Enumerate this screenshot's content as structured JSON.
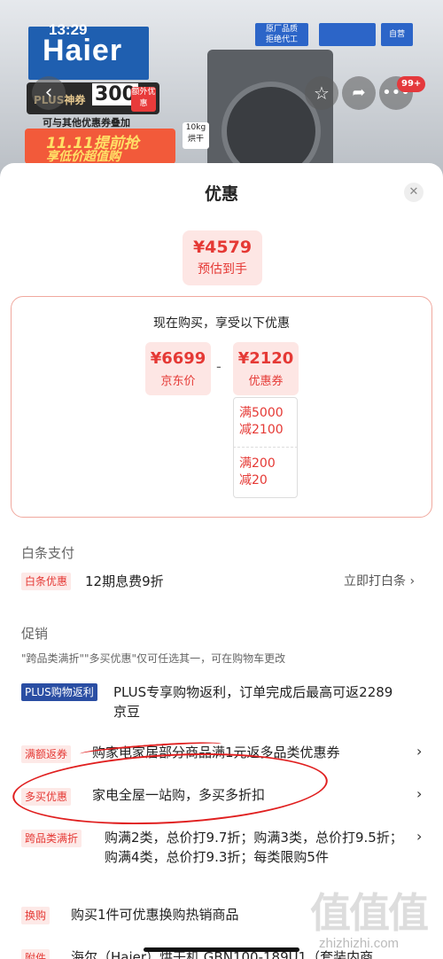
{
  "header": {
    "time": "13:29",
    "brand": "Haier",
    "tags": [
      "原厂品质",
      "拒绝代工",
      "",
      "自营"
    ],
    "plus_coupon": "PLUS神券",
    "plus_amount": "300",
    "extra_badge": "额外优惠",
    "plus_sub": "可与其他优惠券叠加",
    "promo_title": "11.11提前抢",
    "promo_sub": "享低价超值购",
    "kg": "10kg 烘干",
    "back_icon": "chevron-left-icon",
    "cart_badge": "99+"
  },
  "sheet": {
    "title": "优惠",
    "estimate_price": "¥4579",
    "estimate_label": "预估到手",
    "detail_heading": "现在购买，享受以下优惠",
    "jd_price": "¥6699",
    "jd_label": "京东价",
    "minus": "-",
    "coupon_total": "¥2120",
    "coupon_label": "优惠券",
    "coupons": [
      {
        "line1": "满5000",
        "line2": "减2100"
      },
      {
        "line1": "满200",
        "line2": "减20"
      }
    ]
  },
  "baitiao": {
    "section": "白条支付",
    "tag": "白条优惠",
    "text": "12期息费9折",
    "action": "立即打白条"
  },
  "promo": {
    "section": "促销",
    "note": "\"跨品类满折\"\"多买优惠\"仅可任选其一，可在购物车更改",
    "rows": [
      {
        "tag": "PLUS购物返利",
        "text": "PLUS专享购物返利，订单完成后最高可返2289京豆"
      },
      {
        "tag": "满额返券",
        "text": "购家电家居部分商品满1元返多品类优惠券"
      },
      {
        "tag": "多买优惠",
        "text": "家电全屋一站购，多买多折扣"
      },
      {
        "tag": "跨品类满折",
        "text": "购满2类，总价打9.7折；购满3类，总价打9.5折；购满4类，总价打9.3折；每类限购5件"
      },
      {
        "tag": "换购",
        "text": "购买1件可优惠换购热销商品"
      },
      {
        "tag": "附件",
        "text": "海尔（Haier）烘干机 GBN100-189U1（套装内商"
      }
    ]
  },
  "watermark": {
    "logo": "值值值",
    "site": "zhizhizhi.com"
  },
  "colors": {
    "accent": "#e53935",
    "plus": "#2a4ea3"
  }
}
